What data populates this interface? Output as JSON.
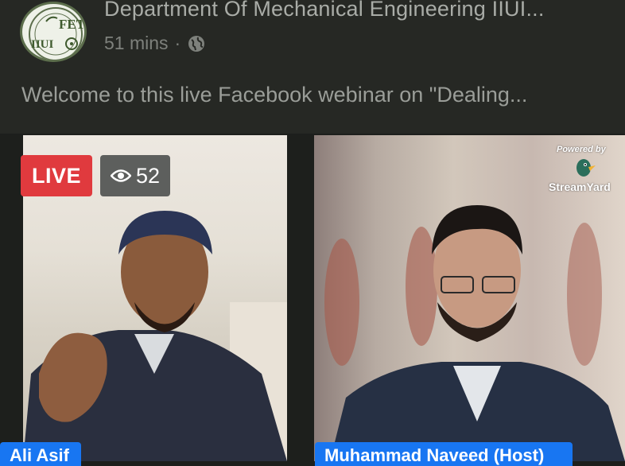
{
  "post": {
    "page_name": "Department Of Mechanical Engineering IIUI...",
    "time": "51 mins",
    "separator": "·",
    "description": "Welcome to this live Facebook webinar on \"Dealing...",
    "avatar_text_top": "FET",
    "avatar_text_left": "IIUI"
  },
  "stream": {
    "live_label": "LIVE",
    "viewer_count": "52",
    "powered_by": "Powered by",
    "brand": "StreamYard",
    "speakers": [
      {
        "name": "Ali Asif"
      },
      {
        "name": "Muhammad Naveed (Host)"
      }
    ]
  },
  "colors": {
    "live": "#e03a3e",
    "name_tag": "#1876f2"
  }
}
